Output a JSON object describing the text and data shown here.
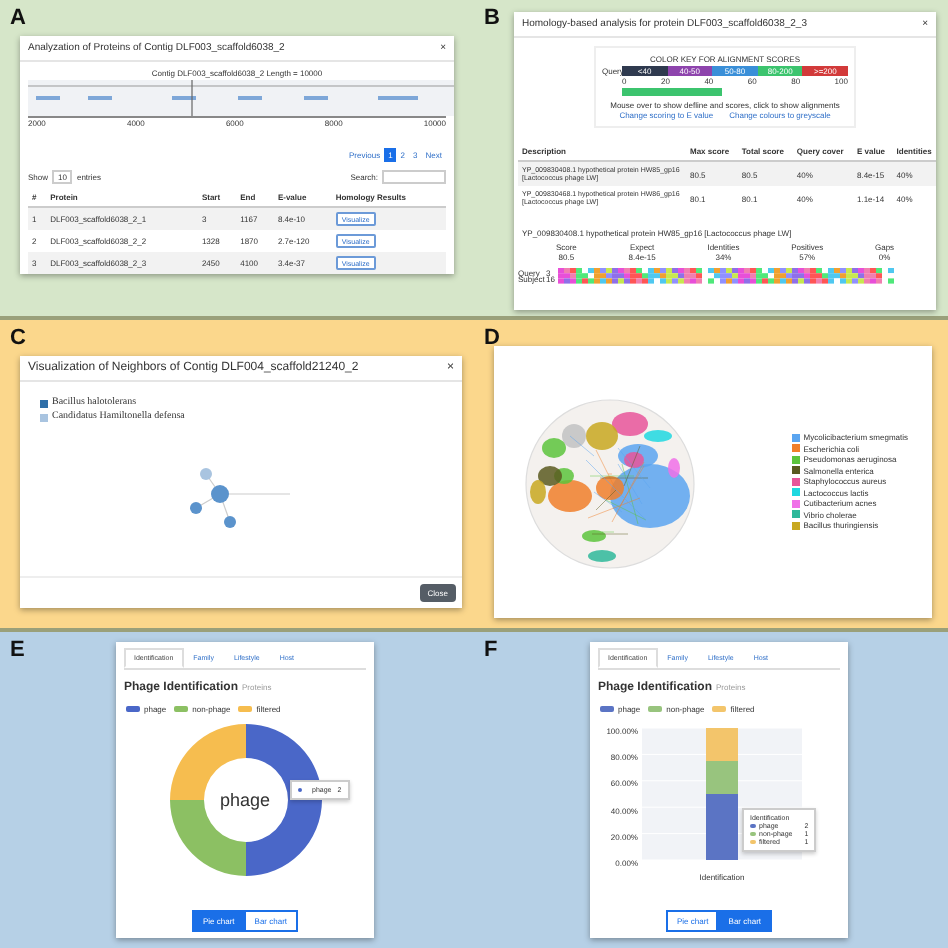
{
  "panel_a": {
    "letter": "A",
    "title": "Analyzation of Proteins of Contig DLF003_scaffold6038_2",
    "close": "×",
    "plot_title": "Contig DLF003_scaffold6038_2 Length = 10000",
    "axis_ticks": [
      "2000",
      "4000",
      "6000",
      "8000",
      "10000"
    ],
    "pagination": [
      {
        "label": "Previous",
        "selected": false
      },
      {
        "label": "1",
        "selected": true
      },
      {
        "label": "2",
        "selected": false
      },
      {
        "label": "3",
        "selected": false
      },
      {
        "label": "Next",
        "selected": false
      }
    ],
    "show": "Show",
    "page_size": "10",
    "entries": "entries",
    "search_label": "Search:",
    "columns": [
      "#",
      "Protein",
      "Start",
      "End",
      "E-value",
      "Homology Results"
    ],
    "rows": [
      {
        "cells": [
          "1",
          "DLF003_scaffold6038_2_1",
          "3",
          "1167",
          "8.4e-10"
        ],
        "button": "Visualize"
      },
      {
        "cells": [
          "2",
          "DLF003_scaffold6038_2_2",
          "1328",
          "1870",
          "2.7e-120"
        ],
        "button": "Visualize"
      },
      {
        "cells": [
          "3",
          "DLF003_scaffold6038_2_3",
          "2450",
          "4100",
          "3.4e-37"
        ],
        "button": "Visualize"
      }
    ]
  },
  "panel_b": {
    "letter": "B",
    "title": "Homology-based analysis for protein DLF003_scaffold6038_2_3",
    "close": "×",
    "key_title": "COLOR KEY FOR ALIGNMENT SCORES",
    "key": [
      {
        "label": "<40",
        "color": "#2f3a4f"
      },
      {
        "label": "40-50",
        "color": "#8e44ad"
      },
      {
        "label": "50-80",
        "color": "#3a8fd8"
      },
      {
        "label": "80-200",
        "color": "#3cc46e"
      },
      {
        "label": ">=200",
        "color": "#d23a3a"
      }
    ],
    "query_label": "Query",
    "axis_ticks": [
      "0",
      "20",
      "40",
      "60",
      "80",
      "100"
    ],
    "hint": "Mouse over to show defline and scores, click to show alignments",
    "links": [
      "Change scoring to E value",
      "Change colours to greyscale"
    ],
    "columns": [
      "Description",
      "Max score",
      "Total score",
      "Query cover",
      "E value",
      "Identities"
    ],
    "rows": [
      {
        "cells": [
          "YP_009830408.1 hypothetical protein HW85_gp16 [Lactococcus phage LW]",
          "80.5",
          "80.5",
          "40%",
          "8.4e-15",
          "40%"
        ],
        "selected": true
      },
      {
        "cells": [
          "YP_009830468.1 hypothetical protein HW86_gp16 [Lactococcus phage LW]",
          "80.1",
          "80.1",
          "40%",
          "1.1e-14",
          "40%"
        ],
        "selected": false
      }
    ],
    "alignment_title": "YP_009830408.1 hypothetical protein HW85_gp16 [Lactococcus phage LW]",
    "stats": [
      {
        "label": "Score",
        "value": "80.5"
      },
      {
        "label": "Expect",
        "value": "8.4e-15"
      },
      {
        "label": "Identities",
        "value": "34%"
      },
      {
        "label": "Positives",
        "value": "57%"
      },
      {
        "label": "Gaps",
        "value": "0%"
      }
    ],
    "sequences": [
      {
        "label": "Query",
        "start": "3"
      },
      {
        "label": "Subject",
        "start": "16"
      }
    ]
  },
  "panel_c": {
    "letter": "C",
    "title": "Visualization of Neighbors of Contig DLF004_scaffold21240_2",
    "close": "×",
    "legend": [
      {
        "label": "Bacillus halotolerans",
        "color": "#2f6fa8"
      },
      {
        "label": "Candidatus Hamiltonella defensa",
        "color": "#a9c4e0"
      }
    ],
    "button": "Close"
  },
  "panel_d": {
    "letter": "D",
    "legend": [
      {
        "label": "Mycolicibacterium smegmatis",
        "color": "#5aa5f0"
      },
      {
        "label": "Escherichia coli",
        "color": "#f07f2a"
      },
      {
        "label": "Pseudomonas aeruginosa",
        "color": "#5cc43c"
      },
      {
        "label": "Salmonella enterica",
        "color": "#5a5a20"
      },
      {
        "label": "Staphylococcus aureus",
        "color": "#e8559a"
      },
      {
        "label": "Lactococcus lactis",
        "color": "#1ed8e0"
      },
      {
        "label": "Cutibacterium acnes",
        "color": "#f070e8"
      },
      {
        "label": "Vibrio cholerae",
        "color": "#2eb89a"
      },
      {
        "label": "Bacillus thuringiensis",
        "color": "#c8a820"
      }
    ]
  },
  "panel_e": {
    "letter": "E",
    "tabs": [
      {
        "label": "Identification",
        "selected": true
      },
      {
        "label": "Family",
        "selected": false
      },
      {
        "label": "Lifestyle",
        "selected": false
      },
      {
        "label": "Host",
        "selected": false
      }
    ],
    "heading": "Phage Identification",
    "subheading": "Proteins",
    "chart_data": {
      "type": "donut",
      "legend": "top",
      "categories": [
        "phage",
        "non-phage",
        "filtered"
      ],
      "values": [
        50,
        25,
        25
      ],
      "colors": [
        "#4a67c8",
        "#8cc063",
        "#f6bd4f"
      ]
    },
    "center_label": "phage",
    "tooltip": {
      "label": "phage",
      "value": "2"
    },
    "buttons": [
      {
        "label": "Pie chart",
        "selected": true
      },
      {
        "label": "Bar chart",
        "selected": false
      }
    ]
  },
  "panel_f": {
    "letter": "F",
    "tabs": [
      {
        "label": "Identification",
        "selected": true
      },
      {
        "label": "Family",
        "selected": false
      },
      {
        "label": "Lifestyle",
        "selected": false
      },
      {
        "label": "Host",
        "selected": false
      }
    ],
    "heading": "Phage Identification",
    "subheading": "Proteins",
    "chart_data": {
      "type": "bar",
      "stacked": true,
      "grid": true,
      "legend": "top",
      "categories": [
        "Identification"
      ],
      "ylim": [
        0,
        100
      ],
      "yticks": [
        {
          "value": 0,
          "label": "0.00%"
        },
        {
          "value": 20,
          "label": "20.00%"
        },
        {
          "value": 40,
          "label": "40.00%"
        },
        {
          "value": 60,
          "label": "60.00%"
        },
        {
          "value": 80,
          "label": "80.00%"
        },
        {
          "value": 100,
          "label": "100.00%"
        }
      ],
      "series": [
        {
          "name": "phage",
          "color": "#5b74c4",
          "values": [
            50
          ]
        },
        {
          "name": "non-phage",
          "color": "#98c47e",
          "values": [
            25
          ]
        },
        {
          "name": "filtered",
          "color": "#f3c56b",
          "values": [
            25
          ]
        }
      ]
    },
    "tooltip": {
      "title": "Identification",
      "items": [
        {
          "label": "phage",
          "value": "2"
        },
        {
          "label": "non-phage",
          "value": "1"
        },
        {
          "label": "filtered",
          "value": "1"
        }
      ]
    },
    "buttons": [
      {
        "label": "Pie chart",
        "selected": false
      },
      {
        "label": "Bar chart",
        "selected": true
      }
    ]
  }
}
